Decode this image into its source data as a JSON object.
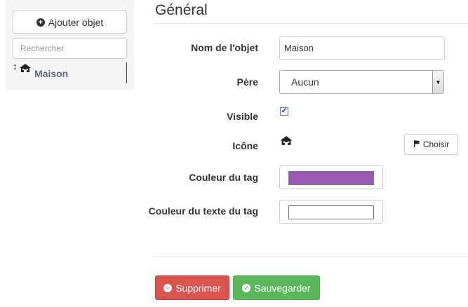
{
  "sidebar": {
    "add_label": "Ajouter objet",
    "add_icon": "plus-circle-icon",
    "search_placeholder": "Rechercher",
    "items": [
      {
        "label": "Maison",
        "icon": "house-icon"
      }
    ]
  },
  "main": {
    "title": "Général",
    "fields": {
      "name_label": "Nom de l'objet",
      "name_value": "Maison",
      "parent_label": "Père",
      "parent_value": "Aucun",
      "visible_label": "Visible",
      "visible_checked": true,
      "icon_label": "Icône",
      "icon_name": "house-icon",
      "choose_label": "Choisir",
      "tag_color_label": "Couleur du tag",
      "tag_color_value": "#9b59b6",
      "tag_text_color_label": "Couleur du texte du tag",
      "tag_text_color_value": "#ffffff"
    },
    "actions": {
      "delete_label": "Supprimer",
      "save_label": "Sauvegarder"
    }
  },
  "colors": {
    "danger": "#d9534f",
    "success": "#5cb85c",
    "tree_label": "#5a6a8a"
  }
}
